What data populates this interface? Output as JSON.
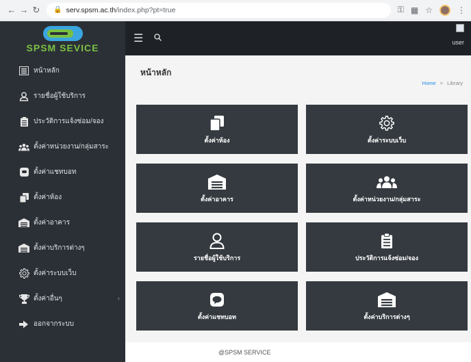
{
  "browser": {
    "url_host": "serv.spsm.ac.th",
    "url_path": "/index.php?pt=true"
  },
  "brand": {
    "name": "SPSM SEVICE",
    "logo_colors": [
      "#3aa6e0",
      "#7bc043"
    ]
  },
  "topbar": {
    "user_label": "user"
  },
  "sidebar": {
    "items": [
      {
        "label": "หน้าหลัก",
        "icon": "list-icon"
      },
      {
        "label": "รายชื่อผู้ใช้บริการ",
        "icon": "user-icon"
      },
      {
        "label": "ประวัติการแจ้งซ่อม/จอง",
        "icon": "clipboard-icon"
      },
      {
        "label": "ตั้งค่าหน่วยงาน/กลุ่มสาระ",
        "icon": "users-icon"
      },
      {
        "label": "ตั้งค่าแชทบอท",
        "icon": "chat-icon"
      },
      {
        "label": "ตั้งค่าห้อง",
        "icon": "copy-icon"
      },
      {
        "label": "ตั้งค่าอาคาร",
        "icon": "warehouse-icon"
      },
      {
        "label": "ตั้งค่าบริการต่างๆ",
        "icon": "warehouse-icon"
      },
      {
        "label": "ตั้งค่าระบบเว็บ",
        "icon": "gear-icon"
      },
      {
        "label": "ตั้งค่าอื่นๆ",
        "icon": "trophy-icon"
      },
      {
        "label": "ออกจากระบบ",
        "icon": "sign-out-icon"
      }
    ]
  },
  "page": {
    "title": "หน้าหลัก",
    "breadcrumb": {
      "home": "Home",
      "separator": ">",
      "current": "Library"
    }
  },
  "tiles": [
    {
      "label": "ตั้งค่าห้อง",
      "icon": "copy-icon"
    },
    {
      "label": "ตั้งค่าระบบเว็บ",
      "icon": "gear-icon"
    },
    {
      "label": "ตั้งค่าอาคาร",
      "icon": "warehouse-icon"
    },
    {
      "label": "ตั้งค่าหน่วยงาน/กลุ่มสาระ",
      "icon": "users-icon"
    },
    {
      "label": "รายชื่อผู้ใช้บริการ",
      "icon": "user-icon"
    },
    {
      "label": "ประวัติการแจ้งซ่อม/จอง",
      "icon": "clipboard-icon"
    },
    {
      "label": "ตั้งค่าแชทบอท",
      "icon": "line-icon"
    },
    {
      "label": "ตั้งค่าบริการต่างๆ",
      "icon": "warehouse-icon"
    }
  ],
  "footer": {
    "text": "@SPSM SERVICE"
  }
}
